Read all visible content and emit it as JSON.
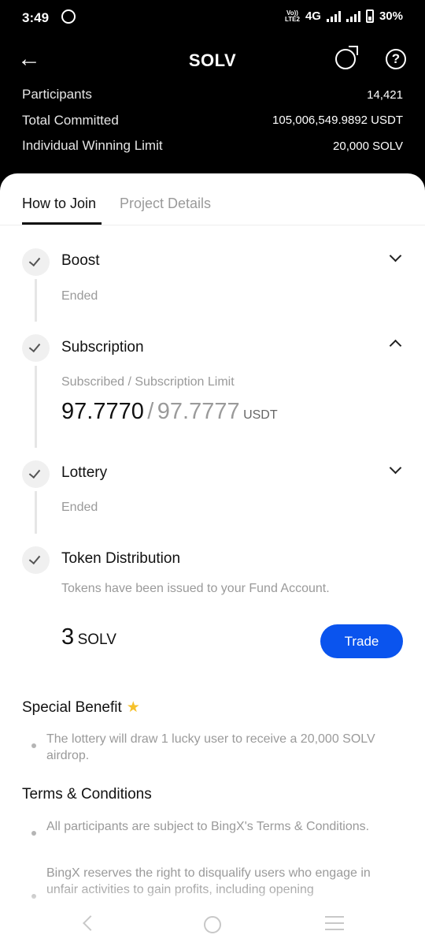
{
  "status_bar": {
    "time": "3:49",
    "network_top": "Vo))",
    "network_bottom": "LTE2",
    "network_type": "4G",
    "battery": "30%",
    "icons": [
      "whatsapp-icon",
      "signal-icon",
      "battery-icon"
    ]
  },
  "header": {
    "title": "SOLV",
    "back_icon": "arrow-left-icon",
    "share_icon": "share-icon",
    "help_icon": "help-icon",
    "help_glyph": "?"
  },
  "stats": [
    {
      "label": "Participants",
      "value": "14,421"
    },
    {
      "label": "Total Committed",
      "value": "105,006,549.9892 USDT"
    },
    {
      "label": "Individual Winning Limit",
      "value": "20,000 SOLV"
    }
  ],
  "tabs": [
    {
      "label": "How to Join",
      "active": true
    },
    {
      "label": "Project Details",
      "active": false
    }
  ],
  "steps": {
    "boost": {
      "title": "Boost",
      "status": "Ended",
      "expanded": false
    },
    "subscription": {
      "title": "Subscription",
      "caption": "Subscribed / Subscription Limit",
      "subscribed": "97.7770",
      "separator": "/",
      "limit": "97.7777",
      "unit": "USDT",
      "expanded": true
    },
    "lottery": {
      "title": "Lottery",
      "status": "Ended",
      "expanded": false
    },
    "distribution": {
      "title": "Token Distribution",
      "note": "Tokens have been issued to your Fund Account.",
      "amount": "3",
      "unit": "SOLV",
      "trade_label": "Trade"
    }
  },
  "special_benefit": {
    "title": "Special Benefit",
    "icon": "star-icon",
    "items": [
      "The lottery will draw 1 lucky user to receive a 20,000 SOLV airdrop."
    ]
  },
  "terms": {
    "title": "Terms & Conditions",
    "items": [
      "All participants are subject to BingX's Terms & Conditions.",
      "BingX reserves the right to disqualify users who engage in unfair activities to gain profits, including opening"
    ]
  },
  "colors": {
    "accent": "#0a54ee",
    "header_bg": "#000000",
    "star": "#f6c12a",
    "muted_text": "#9a9a9a"
  }
}
